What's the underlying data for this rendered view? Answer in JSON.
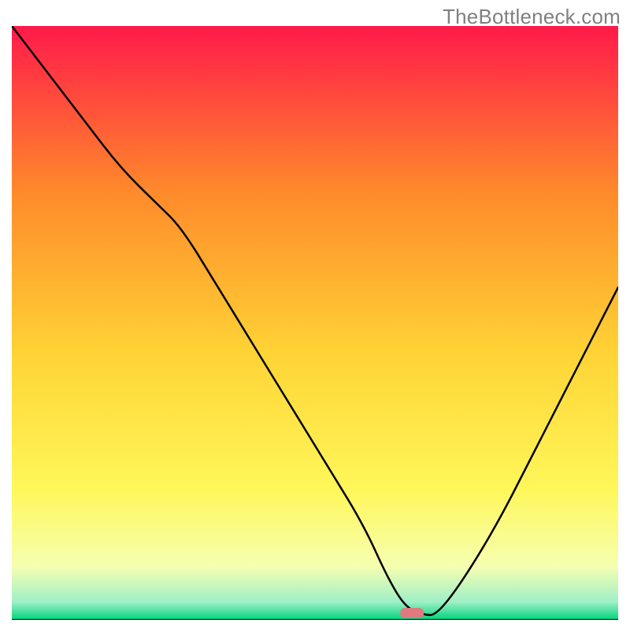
{
  "watermark": "TheBottleneck.com",
  "chart_data": {
    "type": "line",
    "title": "",
    "xlabel": "",
    "ylabel": "",
    "xlim": [
      0,
      100
    ],
    "ylim": [
      0,
      100
    ],
    "grid": false,
    "legend": false,
    "background_gradient": {
      "top": "#ff1a4a",
      "mid_upper": "#ff8a2b",
      "mid": "#ffd335",
      "mid_lower": "#fff75a",
      "low": "#f6ffb0",
      "bottom": "#00d47a"
    },
    "marker": {
      "x": 66,
      "y": 1.2,
      "color": "#e07a80"
    },
    "series": [
      {
        "name": "curve",
        "x": [
          0,
          6,
          12,
          18,
          24,
          28,
          34,
          40,
          46,
          52,
          58,
          62,
          65,
          68,
          70,
          74,
          80,
          86,
          92,
          98,
          100
        ],
        "y": [
          100,
          92,
          84,
          76,
          70,
          66,
          56,
          46,
          36,
          26,
          16,
          7,
          2,
          0.8,
          0.8,
          6,
          16,
          28,
          40,
          52,
          56
        ]
      }
    ]
  }
}
